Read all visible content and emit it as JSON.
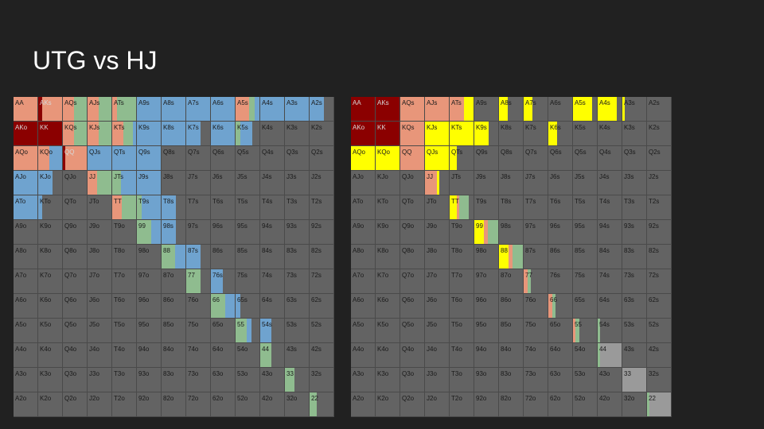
{
  "slide": {
    "title": "UTG vs HJ"
  },
  "colors": {
    "background": "#212121",
    "cell": "#636363",
    "cell_border": "#4a4a4a",
    "dark_red": "#8b0000",
    "salmon": "#e8967a",
    "green": "#8fbc8f",
    "blue": "#6fa3cf",
    "yellow": "#ffff00",
    "light_gray": "#9a9a9a"
  },
  "grid_labels": [
    [
      "AA",
      "AKs",
      "AQs",
      "AJs",
      "ATs",
      "A9s",
      "A8s",
      "A7s",
      "A6s",
      "A5s",
      "A4s",
      "A3s",
      "A2s"
    ],
    [
      "AKo",
      "KK",
      "KQs",
      "KJs",
      "KTs",
      "K9s",
      "K8s",
      "K7s",
      "K6s",
      "K5s",
      "K4s",
      "K3s",
      "K2s"
    ],
    [
      "AQo",
      "KQo",
      "QQ",
      "QJs",
      "QTs",
      "Q9s",
      "Q8s",
      "Q7s",
      "Q6s",
      "Q5s",
      "Q4s",
      "Q3s",
      "Q2s"
    ],
    [
      "AJo",
      "KJo",
      "QJo",
      "JJ",
      "JTs",
      "J9s",
      "J8s",
      "J7s",
      "J6s",
      "J5s",
      "J4s",
      "J3s",
      "J2s"
    ],
    [
      "ATo",
      "KTo",
      "QTo",
      "JTo",
      "TT",
      "T9s",
      "T8s",
      "T7s",
      "T6s",
      "T5s",
      "T4s",
      "T3s",
      "T2s"
    ],
    [
      "A9o",
      "K9o",
      "Q9o",
      "J9o",
      "T9o",
      "99",
      "98s",
      "97s",
      "96s",
      "95s",
      "94s",
      "93s",
      "92s"
    ],
    [
      "A8o",
      "K8o",
      "Q8o",
      "J8o",
      "T8o",
      "98o",
      "88",
      "87s",
      "86s",
      "85s",
      "84s",
      "83s",
      "82s"
    ],
    [
      "A7o",
      "K7o",
      "Q7o",
      "J7o",
      "T7o",
      "97o",
      "87o",
      "77",
      "76s",
      "75s",
      "74s",
      "73s",
      "72s"
    ],
    [
      "A6o",
      "K6o",
      "Q6o",
      "J6o",
      "T6o",
      "96o",
      "86o",
      "76o",
      "66",
      "65s",
      "64s",
      "63s",
      "62s"
    ],
    [
      "A5o",
      "K5o",
      "Q5o",
      "J5o",
      "T5o",
      "95o",
      "85o",
      "75o",
      "65o",
      "55",
      "54s",
      "53s",
      "52s"
    ],
    [
      "A4o",
      "K4o",
      "Q4o",
      "J4o",
      "T4o",
      "94o",
      "84o",
      "74o",
      "64o",
      "54o",
      "44",
      "43s",
      "42s"
    ],
    [
      "A3o",
      "K3o",
      "Q3o",
      "J3o",
      "T3o",
      "93o",
      "83o",
      "73o",
      "63o",
      "53o",
      "43o",
      "33",
      "32s"
    ],
    [
      "A2o",
      "K2o",
      "Q2o",
      "J2o",
      "T2o",
      "92o",
      "82o",
      "72o",
      "62o",
      "52o",
      "42o",
      "32o",
      "22"
    ]
  ],
  "ranges": {
    "left": {
      "AA": [
        [
          "s",
          1.0
        ]
      ],
      "AKs": [
        [
          "r",
          0.15
        ],
        [
          "s",
          0.85
        ]
      ],
      "AQs": [
        [
          "s",
          0.45
        ],
        [
          "g",
          0.55
        ]
      ],
      "AJs": [
        [
          "s",
          0.45
        ],
        [
          "g",
          0.55
        ]
      ],
      "ATs": [
        [
          "s",
          0.2
        ],
        [
          "g",
          0.8
        ]
      ],
      "A9s": [
        [
          "b",
          1.0
        ]
      ],
      "A8s": [
        [
          "b",
          1.0
        ]
      ],
      "A7s": [
        [
          "b",
          1.0
        ]
      ],
      "A6s": [
        [
          "b",
          1.0
        ]
      ],
      "A5s": [
        [
          "s",
          0.55
        ],
        [
          "g",
          0.25
        ],
        [
          "b",
          0.2
        ]
      ],
      "A4s": [
        [
          "b",
          1.0
        ]
      ],
      "A3s": [
        [
          "b",
          1.0
        ]
      ],
      "A2s": [
        [
          "b",
          0.6
        ]
      ],
      "AKo": [
        [
          "r",
          1.0
        ]
      ],
      "KK": [
        [
          "r",
          1.0
        ]
      ],
      "KQs": [
        [
          "s",
          0.45
        ],
        [
          "g",
          0.55
        ]
      ],
      "KJs": [
        [
          "s",
          0.45
        ],
        [
          "g",
          0.55
        ]
      ],
      "KTs": [
        [
          "s",
          0.45
        ],
        [
          "g",
          0.4
        ],
        [
          "b",
          0.15
        ]
      ],
      "K9s": [
        [
          "b",
          1.0
        ]
      ],
      "K8s": [
        [
          "b",
          1.0
        ]
      ],
      "K7s": [
        [
          "b",
          0.6
        ]
      ],
      "K6s": [
        [
          "b",
          1.0
        ]
      ],
      "K5s": [
        [
          "g",
          0.2
        ],
        [
          "b",
          0.5
        ]
      ],
      "AQo": [
        [
          "s",
          1.0
        ]
      ],
      "KQo": [
        [
          "s",
          0.45
        ],
        [
          "b",
          0.55
        ]
      ],
      "QQ": [
        [
          "r",
          0.1
        ],
        [
          "s",
          0.9
        ]
      ],
      "QJs": [
        [
          "b",
          1.0
        ]
      ],
      "QTs": [
        [
          "b",
          1.0
        ]
      ],
      "Q9s": [
        [
          "b",
          1.0
        ]
      ],
      "AJo": [
        [
          "b",
          1.0
        ]
      ],
      "KJo": [
        [
          "b",
          0.6
        ]
      ],
      "JJ": [
        [
          "s",
          0.4
        ],
        [
          "g",
          0.6
        ]
      ],
      "JTs": [
        [
          "g",
          0.35
        ],
        [
          "b",
          0.65
        ]
      ],
      "J9s": [
        [
          "b",
          1.0
        ]
      ],
      "ATo": [
        [
          "b",
          1.0
        ]
      ],
      "KTo": [
        [
          "b",
          0.15
        ]
      ],
      "TT": [
        [
          "s",
          0.4
        ],
        [
          "g",
          0.6
        ]
      ],
      "T9s": [
        [
          "g",
          0.2
        ],
        [
          "b",
          0.8
        ]
      ],
      "T8s": [
        [
          "b",
          0.6
        ]
      ],
      "99": [
        [
          "g",
          0.6
        ],
        [
          "b",
          0.4
        ]
      ],
      "98s": [
        [
          "b",
          0.6
        ]
      ],
      "88": [
        [
          "g",
          0.55
        ],
        [
          "b",
          0.45
        ]
      ],
      "87s": [
        [
          "b",
          0.6
        ]
      ],
      "77": [
        [
          "g",
          0.6
        ]
      ],
      "76s": [
        [
          "b",
          0.5
        ]
      ],
      "66": [
        [
          "g",
          0.6
        ],
        [
          "b",
          0.4
        ]
      ],
      "65s": [
        [
          "b",
          0.2
        ]
      ],
      "55": [
        [
          "g",
          0.45
        ],
        [
          "b",
          0.2
        ]
      ],
      "54s": [
        [
          "b",
          0.45
        ]
      ],
      "44": [
        [
          "g",
          0.45
        ]
      ],
      "33": [
        [
          "g",
          0.4
        ]
      ],
      "22": [
        [
          "g",
          0.3
        ]
      ]
    },
    "right": {
      "AA": [
        [
          "r",
          1.0
        ]
      ],
      "AKs": [
        [
          "r",
          1.0
        ]
      ],
      "AQs": [
        [
          "s",
          1.0
        ]
      ],
      "AJs": [
        [
          "s",
          1.0
        ]
      ],
      "ATs": [
        [
          "s",
          0.6
        ],
        [
          "y",
          0.4
        ]
      ],
      "A8s": [
        [
          "y",
          0.35
        ]
      ],
      "A7s": [
        [
          "y",
          0.35
        ]
      ],
      "A5s": [
        [
          "y",
          0.8
        ]
      ],
      "A4s": [
        [
          "y",
          0.8
        ]
      ],
      "A3s": [
        [
          "y",
          0.1
        ]
      ],
      "AKo": [
        [
          "r",
          1.0
        ]
      ],
      "KK": [
        [
          "r",
          1.0
        ]
      ],
      "KQs": [
        [
          "s",
          1.0
        ]
      ],
      "KJs": [
        [
          "y",
          1.0
        ]
      ],
      "KTs": [
        [
          "y",
          1.0
        ]
      ],
      "K9s": [
        [
          "y",
          0.6
        ]
      ],
      "K6s": [
        [
          "y",
          0.35
        ]
      ],
      "AQo": [
        [
          "y",
          1.0
        ]
      ],
      "KQo": [
        [
          "y",
          1.0
        ]
      ],
      "QQ": [
        [
          "s",
          1.0
        ]
      ],
      "QJs": [
        [
          "y",
          1.0
        ]
      ],
      "QTs": [
        [
          "y",
          0.3
        ]
      ],
      "JJ": [
        [
          "s",
          0.5
        ],
        [
          "y",
          0.1
        ]
      ],
      "TT": [
        [
          "y",
          0.3
        ],
        [
          "s",
          0.1
        ],
        [
          "g",
          0.4
        ]
      ],
      "99": [
        [
          "y",
          0.4
        ],
        [
          "s",
          0.15
        ],
        [
          "g",
          0.45
        ]
      ],
      "88": [
        [
          "y",
          0.4
        ],
        [
          "s",
          0.15
        ],
        [
          "g",
          0.45
        ]
      ],
      "77": [
        [
          "s",
          0.15
        ],
        [
          "g",
          0.15
        ]
      ],
      "66": [
        [
          "s",
          0.15
        ],
        [
          "g",
          0.15
        ]
      ],
      "55": [
        [
          "s",
          0.1
        ],
        [
          "g",
          0.15
        ]
      ],
      "54s": [
        [
          "g",
          0.1
        ]
      ],
      "44": [
        [
          "g",
          0.1
        ],
        [
          "l",
          0.9
        ]
      ],
      "33": [
        [
          "l",
          1.0
        ]
      ],
      "22": [
        [
          "g",
          0.1
        ],
        [
          "l",
          0.9
        ]
      ]
    }
  }
}
